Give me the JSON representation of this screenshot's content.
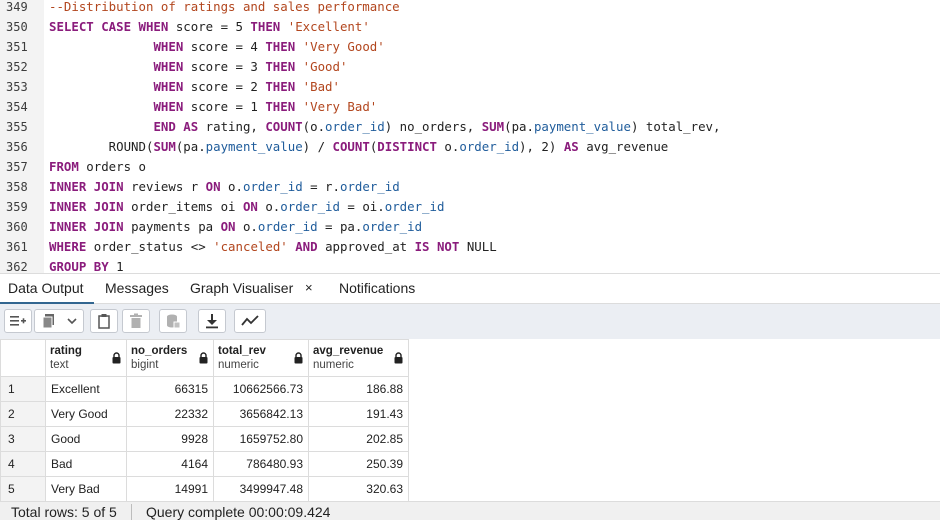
{
  "editor": {
    "lines": [
      {
        "num": "349",
        "tokens": [
          {
            "t": "--Distribution of ratings and sales performance",
            "c": "cm"
          }
        ]
      },
      {
        "num": "350",
        "tokens": [
          {
            "t": "SELECT CASE WHEN",
            "c": "kw"
          },
          {
            "t": " score = 5 "
          },
          {
            "t": "THEN",
            "c": "kw"
          },
          {
            "t": " "
          },
          {
            "t": "'Excellent'",
            "c": "str"
          }
        ]
      },
      {
        "num": "351",
        "tokens": [
          {
            "t": "              "
          },
          {
            "t": "WHEN",
            "c": "kw"
          },
          {
            "t": " score = 4 "
          },
          {
            "t": "THEN",
            "c": "kw"
          },
          {
            "t": " "
          },
          {
            "t": "'Very Good'",
            "c": "str"
          }
        ]
      },
      {
        "num": "352",
        "tokens": [
          {
            "t": "              "
          },
          {
            "t": "WHEN",
            "c": "kw"
          },
          {
            "t": " score = 3 "
          },
          {
            "t": "THEN",
            "c": "kw"
          },
          {
            "t": " "
          },
          {
            "t": "'Good'",
            "c": "str"
          }
        ]
      },
      {
        "num": "353",
        "tokens": [
          {
            "t": "              "
          },
          {
            "t": "WHEN",
            "c": "kw"
          },
          {
            "t": " score = 2 "
          },
          {
            "t": "THEN",
            "c": "kw"
          },
          {
            "t": " "
          },
          {
            "t": "'Bad'",
            "c": "str"
          }
        ]
      },
      {
        "num": "354",
        "tokens": [
          {
            "t": "              "
          },
          {
            "t": "WHEN",
            "c": "kw"
          },
          {
            "t": " score = 1 "
          },
          {
            "t": "THEN",
            "c": "kw"
          },
          {
            "t": " "
          },
          {
            "t": "'Very Bad'",
            "c": "str"
          }
        ]
      },
      {
        "num": "355",
        "tokens": [
          {
            "t": "              "
          },
          {
            "t": "END AS",
            "c": "kw"
          },
          {
            "t": " rating, "
          },
          {
            "t": "COUNT",
            "c": "kw"
          },
          {
            "t": "(o."
          },
          {
            "t": "order_id",
            "c": "fld"
          },
          {
            "t": ") no_orders, "
          },
          {
            "t": "SUM",
            "c": "kw"
          },
          {
            "t": "(pa."
          },
          {
            "t": "payment_value",
            "c": "fld"
          },
          {
            "t": ") total_rev,"
          }
        ]
      },
      {
        "num": "356",
        "tokens": [
          {
            "t": "        ROUND("
          },
          {
            "t": "SUM",
            "c": "kw"
          },
          {
            "t": "(pa."
          },
          {
            "t": "payment_value",
            "c": "fld"
          },
          {
            "t": ") / "
          },
          {
            "t": "COUNT",
            "c": "kw"
          },
          {
            "t": "("
          },
          {
            "t": "DISTINCT",
            "c": "kw"
          },
          {
            "t": " o."
          },
          {
            "t": "order_id",
            "c": "fld"
          },
          {
            "t": "), 2) "
          },
          {
            "t": "AS",
            "c": "kw"
          },
          {
            "t": " avg_revenue"
          }
        ]
      },
      {
        "num": "357",
        "tokens": [
          {
            "t": "FROM",
            "c": "kw"
          },
          {
            "t": " orders o"
          }
        ]
      },
      {
        "num": "358",
        "tokens": [
          {
            "t": "INNER JOIN",
            "c": "kw"
          },
          {
            "t": " reviews r "
          },
          {
            "t": "ON",
            "c": "kw"
          },
          {
            "t": " o."
          },
          {
            "t": "order_id",
            "c": "fld"
          },
          {
            "t": " = r."
          },
          {
            "t": "order_id",
            "c": "fld"
          }
        ]
      },
      {
        "num": "359",
        "tokens": [
          {
            "t": "INNER JOIN",
            "c": "kw"
          },
          {
            "t": " order_items oi "
          },
          {
            "t": "ON",
            "c": "kw"
          },
          {
            "t": " o."
          },
          {
            "t": "order_id",
            "c": "fld"
          },
          {
            "t": " = oi."
          },
          {
            "t": "order_id",
            "c": "fld"
          }
        ]
      },
      {
        "num": "360",
        "tokens": [
          {
            "t": "INNER JOIN",
            "c": "kw"
          },
          {
            "t": " payments pa "
          },
          {
            "t": "ON",
            "c": "kw"
          },
          {
            "t": " o."
          },
          {
            "t": "order_id",
            "c": "fld"
          },
          {
            "t": " = pa."
          },
          {
            "t": "order_id",
            "c": "fld"
          }
        ]
      },
      {
        "num": "361",
        "tokens": [
          {
            "t": "WHERE",
            "c": "kw"
          },
          {
            "t": " order_status <> "
          },
          {
            "t": "'canceled'",
            "c": "str"
          },
          {
            "t": " "
          },
          {
            "t": "AND",
            "c": "kw"
          },
          {
            "t": " approved_at "
          },
          {
            "t": "IS NOT",
            "c": "kw"
          },
          {
            "t": " NULL"
          }
        ]
      },
      {
        "num": "362",
        "tokens": [
          {
            "t": "GROUP BY",
            "c": "kw"
          },
          {
            "t": " 1"
          }
        ]
      }
    ]
  },
  "tabs": {
    "data_output": "Data Output",
    "messages": "Messages",
    "graph_visualiser": "Graph Visualiser",
    "close_glyph": "×",
    "notifications": "Notifications"
  },
  "toolbar": {
    "buttons": [
      "add-row-icon",
      "copy-icon",
      "dropdown-icon",
      "paste-icon",
      "delete-icon",
      "save-data-icon",
      "download-icon",
      "graph-icon"
    ]
  },
  "grid": {
    "columns": [
      {
        "name": "rating",
        "type": "text"
      },
      {
        "name": "no_orders",
        "type": "bigint"
      },
      {
        "name": "total_rev",
        "type": "numeric"
      },
      {
        "name": "avg_revenue",
        "type": "numeric"
      }
    ],
    "rows": [
      {
        "n": "1",
        "rating": "Excellent",
        "no_orders": "66315",
        "total_rev": "10662566.73",
        "avg_revenue": "186.88"
      },
      {
        "n": "2",
        "rating": "Very Good",
        "no_orders": "22332",
        "total_rev": "3656842.13",
        "avg_revenue": "191.43"
      },
      {
        "n": "3",
        "rating": "Good",
        "no_orders": "9928",
        "total_rev": "1659752.80",
        "avg_revenue": "202.85"
      },
      {
        "n": "4",
        "rating": "Bad",
        "no_orders": "4164",
        "total_rev": "786480.93",
        "avg_revenue": "250.39"
      },
      {
        "n": "5",
        "rating": "Very Bad",
        "no_orders": "14991",
        "total_rev": "3499947.48",
        "avg_revenue": "320.63"
      }
    ]
  },
  "status": {
    "total_rows": "Total rows: 5 of 5",
    "query": "Query complete 00:00:09.424"
  },
  "colors": {
    "keyword": "#8a1c7c",
    "string": "#b2461e",
    "identifier": "#1f5c9b",
    "accent": "#326690"
  }
}
